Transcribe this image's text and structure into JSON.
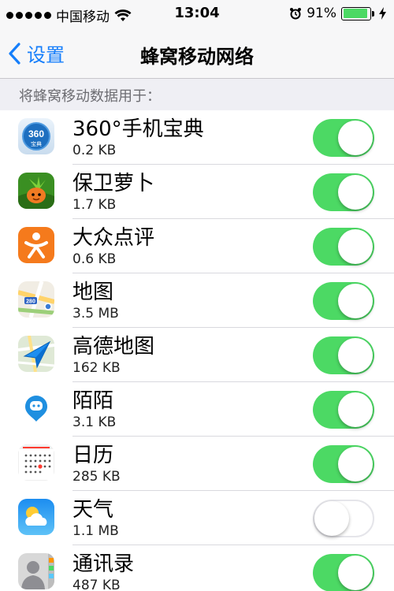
{
  "status_bar": {
    "carrier": "中国移动",
    "time": "13:04",
    "battery": "91%",
    "battery_level": 0.91
  },
  "nav": {
    "back_label": "设置",
    "title": "蜂窝移动网络"
  },
  "section": {
    "header": "将蜂窝移动数据用于："
  },
  "colors": {
    "accent": "#157efb",
    "toggle_on": "#4cd964"
  },
  "apps": [
    {
      "name": "360°手机宝典",
      "size": "0.2 KB",
      "enabled": true,
      "icon": "360-security-icon",
      "icon_text": "360",
      "icon_subtext": "宝典"
    },
    {
      "name": "保卫萝卜",
      "size": "1.7 KB",
      "enabled": true,
      "icon": "carrot-defense-icon"
    },
    {
      "name": "大众点评",
      "size": "0.6 KB",
      "enabled": true,
      "icon": "dianping-icon"
    },
    {
      "name": "地图",
      "size": "3.5 MB",
      "enabled": true,
      "icon": "maps-icon",
      "icon_text": "280"
    },
    {
      "name": "高德地图",
      "size": "162 KB",
      "enabled": true,
      "icon": "amap-icon"
    },
    {
      "name": "陌陌",
      "size": "3.1 KB",
      "enabled": true,
      "icon": "momo-icon"
    },
    {
      "name": "日历",
      "size": "285 KB",
      "enabled": true,
      "icon": "calendar-icon"
    },
    {
      "name": "天气",
      "size": "1.1 MB",
      "enabled": false,
      "icon": "weather-icon"
    },
    {
      "name": "通讯录",
      "size": "487 KB",
      "enabled": true,
      "icon": "contacts-icon"
    }
  ]
}
